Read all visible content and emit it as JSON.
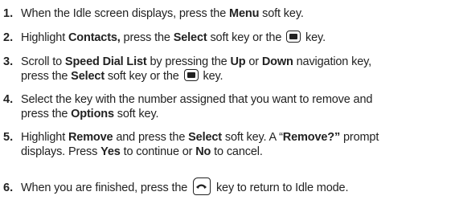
{
  "steps": [
    {
      "num": "1.",
      "lines": [
        [
          {
            "t": "When the Idle screen displays, press the "
          },
          {
            "t": "Menu",
            "b": true
          },
          {
            "t": " soft key."
          }
        ]
      ]
    },
    {
      "num": "2.",
      "lines": [
        [
          {
            "t": "Highlight "
          },
          {
            "t": "Contacts,",
            "b": true
          },
          {
            "t": " press the "
          },
          {
            "t": "Select",
            "b": true
          },
          {
            "t": " soft key or the "
          },
          {
            "icon": "select-key-icon"
          },
          {
            "t": " key."
          }
        ]
      ]
    },
    {
      "num": "3.",
      "lines": [
        [
          {
            "t": "Scroll to "
          },
          {
            "t": "Speed Dial List",
            "b": true
          },
          {
            "t": " by pressing the "
          },
          {
            "t": "Up",
            "b": true
          },
          {
            "t": " or "
          },
          {
            "t": "Down",
            "b": true
          },
          {
            "t": " navigation key,"
          }
        ],
        [
          {
            "t": "press the "
          },
          {
            "t": "Select",
            "b": true
          },
          {
            "t": " soft key or the "
          },
          {
            "icon": "select-key-icon"
          },
          {
            "t": " key."
          }
        ]
      ]
    },
    {
      "num": "4.",
      "lines": [
        [
          {
            "t": "Select the key with the number assigned that you want to remove and"
          }
        ],
        [
          {
            "t": "press the "
          },
          {
            "t": "Options",
            "b": true
          },
          {
            "t": " soft key."
          }
        ]
      ]
    },
    {
      "num": "5.",
      "lines": [
        [
          {
            "t": "Highlight "
          },
          {
            "t": "Remove",
            "b": true
          },
          {
            "t": " and press the "
          },
          {
            "t": "Select",
            "b": true
          },
          {
            "t": " soft key. A “"
          },
          {
            "t": "Remove?”",
            "b": true
          },
          {
            "t": " prompt"
          }
        ],
        [
          {
            "t": "displays. Press "
          },
          {
            "t": "Yes",
            "b": true
          },
          {
            "t": " to continue or "
          },
          {
            "t": "No",
            "b": true
          },
          {
            "t": " to cancel."
          }
        ]
      ]
    },
    {
      "num": "6.",
      "lines": [
        [
          {
            "t": "When you are finished, press the "
          },
          {
            "icon": "end-key-icon"
          },
          {
            "t": " key to return to Idle mode."
          }
        ]
      ]
    }
  ]
}
